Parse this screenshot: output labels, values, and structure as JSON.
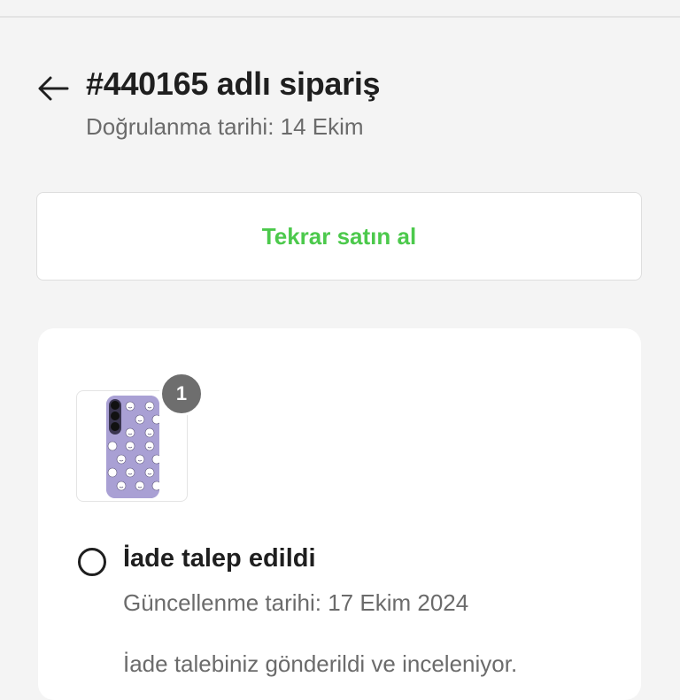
{
  "header": {
    "back_icon": "arrow-left-icon",
    "title": "#440165 adlı sipariş",
    "subtitle": "Doğrulanma tarihi: 14 Ekim"
  },
  "actions": {
    "rebuy_label": "Tekrar satın al",
    "rebuy_color": "#4cc94c"
  },
  "order": {
    "product": {
      "image_icon": "phone-case-image",
      "quantity": "1"
    },
    "status": {
      "icon": "status-circle-icon",
      "title": "İade talep edildi",
      "updated": "Güncellenme tarihi: 17 Ekim 2024",
      "description": "İade talebiniz gönderildi ve inceleniyor."
    }
  }
}
